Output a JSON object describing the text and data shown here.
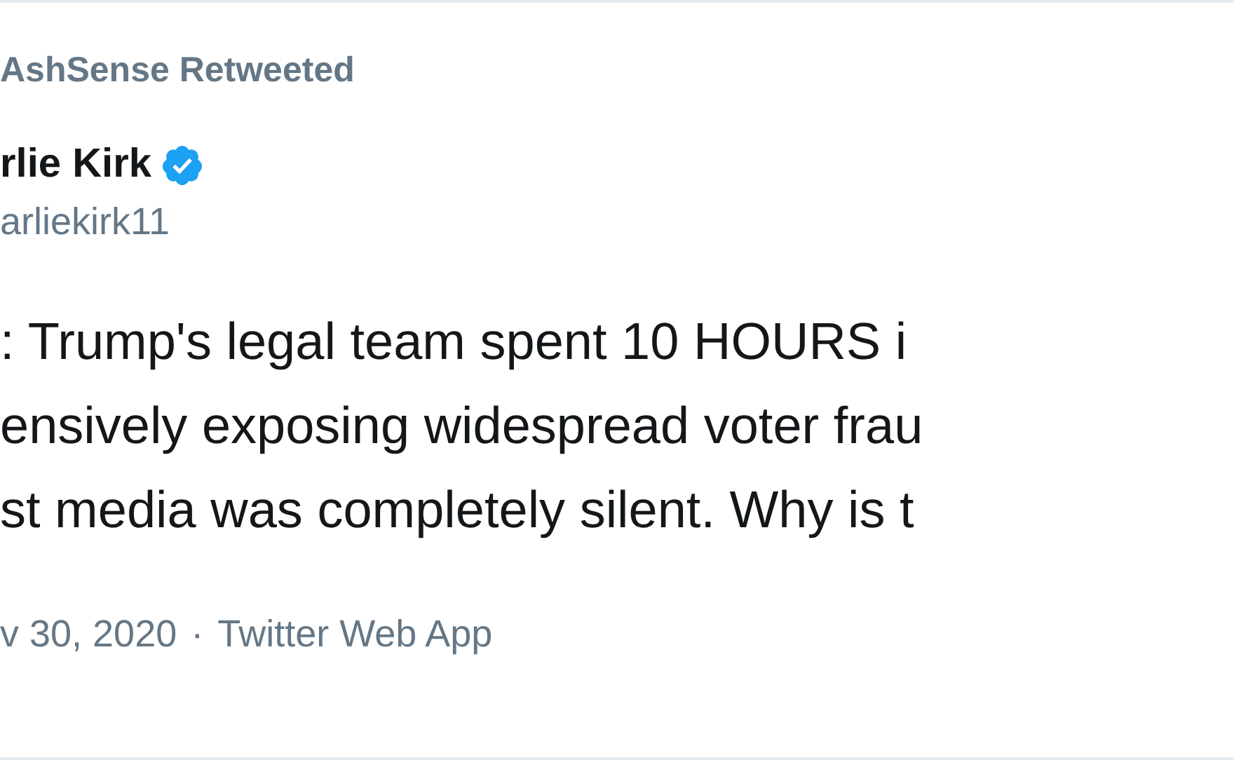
{
  "retweeted_by": "AshSense Retweeted",
  "author": {
    "name": "rlie Kirk",
    "verified": true,
    "handle": "arliekirk11"
  },
  "body_lines": [
    ": Trump's legal team spent 10 HOURS i",
    "ensively exposing widespread voter frau",
    "st media was completely silent. Why is t"
  ],
  "meta": {
    "date": "v 30, 2020",
    "separator": "·",
    "source": "Twitter Web App"
  }
}
